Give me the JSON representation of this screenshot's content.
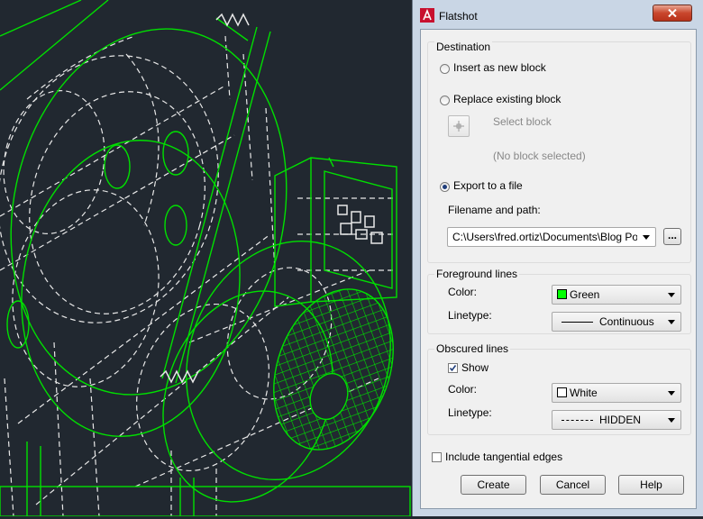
{
  "dialog": {
    "title": "Flatshot",
    "destination": {
      "legend": "Destination",
      "insert_new_block": "Insert as new block",
      "replace_existing_block": "Replace existing block",
      "select_block": "Select block",
      "no_block_selected": "(No block selected)",
      "export_to_file": "Export to a file",
      "filename_label": "Filename and path:",
      "filename_value": "C:\\Users\\fred.ortiz\\Documents\\Blog Posts\\",
      "browse_label": "..."
    },
    "selected_destination": "Export to a file",
    "foreground": {
      "legend": "Foreground lines",
      "color_label": "Color:",
      "color_value": "Green",
      "color_swatch": "#00ff00",
      "linetype_label": "Linetype:",
      "linetype_value": "Continuous"
    },
    "obscured": {
      "legend": "Obscured lines",
      "show_label": "Show",
      "show_checked": true,
      "color_label": "Color:",
      "color_value": "White",
      "color_swatch": "#ffffff",
      "linetype_label": "Linetype:",
      "linetype_value": "HIDDEN"
    },
    "include_tangential": {
      "label": "Include tangential edges",
      "checked": false
    },
    "buttons": {
      "create": "Create",
      "cancel": "Cancel",
      "help": "Help"
    }
  },
  "drawing": {
    "background": "#212830",
    "foreground_color": "#00e000",
    "hidden_color": "#e8e8e8"
  }
}
